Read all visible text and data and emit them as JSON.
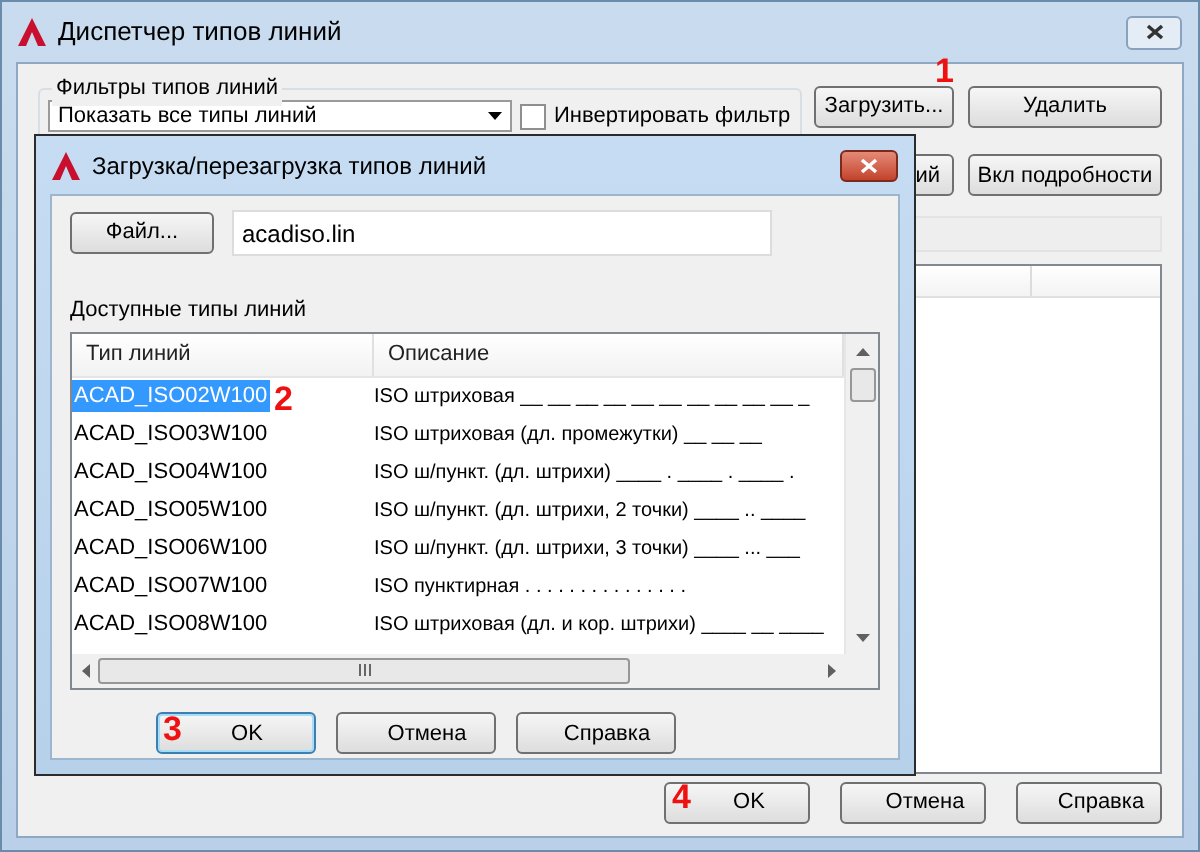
{
  "window": {
    "title": "Диспетчер типов линий"
  },
  "filters": {
    "label": "Фильтры типов линий",
    "dropdown_value": "Показать все типы линий",
    "invert": {
      "label": "Инвертировать фильтр",
      "checked": false
    }
  },
  "top_buttons": [
    {
      "label": "Загрузить...",
      "annotation": "1"
    },
    {
      "label": "Удалить"
    },
    {
      "label": "ий"
    },
    {
      "label": "Вкл подробности"
    }
  ],
  "footer_buttons": [
    {
      "label": "OK",
      "annotation": "4"
    },
    {
      "label": "Отмена"
    },
    {
      "label": "Справка"
    }
  ],
  "dialog": {
    "title": "Загрузка/перезагрузка типов линий",
    "file_button": "Файл...",
    "file_name": "acadiso.lin",
    "list_label": "Доступные типы линий",
    "columns": [
      "Тип линий",
      "Описание"
    ],
    "rows": [
      {
        "name": "ACAD_ISO02W100",
        "description": "ISO штриховая __ __ __ __ __ __ __ __ __ __ _",
        "selected": true,
        "annotation": "2"
      },
      {
        "name": "ACAD_ISO03W100",
        "description": "ISO штриховая (дл. промежутки) __    __    __",
        "selected": false
      },
      {
        "name": "ACAD_ISO04W100",
        "description": "ISO ш/пункт. (дл. штрихи) ____ . ____ . ____ .",
        "selected": false
      },
      {
        "name": "ACAD_ISO05W100",
        "description": "ISO ш/пункт. (дл. штрихи, 2 точки) ____ .. ____",
        "selected": false
      },
      {
        "name": "ACAD_ISO06W100",
        "description": "ISO ш/пункт. (дл. штрихи, 3 точки) ____ ... ___",
        "selected": false
      },
      {
        "name": "ACAD_ISO07W100",
        "description": "ISO пунктирная . . . . . . . . . . . . . . .",
        "selected": false
      },
      {
        "name": "ACAD_ISO08W100",
        "description": "ISO штриховая (дл. и кор. штрихи) ____ __ ____",
        "selected": false
      }
    ],
    "buttons": [
      {
        "label": "OK",
        "annotation": "3",
        "default": true
      },
      {
        "label": "Отмена"
      },
      {
        "label": "Справка"
      }
    ]
  }
}
